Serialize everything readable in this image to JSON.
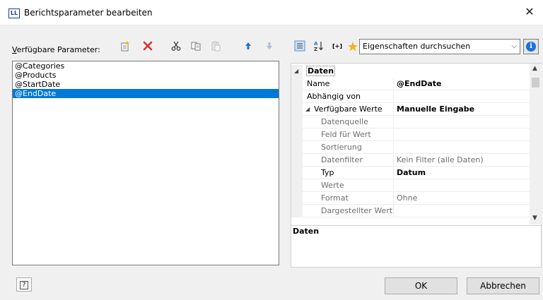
{
  "window": {
    "title": "Berichtsparameter bearbeiten",
    "app_icon_text": "LL"
  },
  "left_panel": {
    "label_accel": "V",
    "label_rest": "erfügbare Parameter:",
    "parameters": [
      "@Categories",
      "@Products",
      "@StartDate",
      "@EndDate"
    ],
    "selected_index": 3
  },
  "search": {
    "placeholder": "Eigenschaften durchsuchen"
  },
  "property_grid": {
    "category": "Daten",
    "rows": [
      {
        "name": "Name",
        "value": "@EndDate",
        "value_style": "bold",
        "sub": false
      },
      {
        "name": "Abhängig von",
        "value": "",
        "value_style": "",
        "sub": false
      },
      {
        "name": "Verfügbare Werte",
        "value": "Manuelle Eingabe",
        "value_style": "bold",
        "sub": false,
        "expander": true
      },
      {
        "name": "Datenquelle",
        "value": "",
        "value_style": "",
        "sub": true
      },
      {
        "name": "Feld für Wert",
        "value": "",
        "value_style": "",
        "sub": true
      },
      {
        "name": "Sortierung",
        "value": "",
        "value_style": "",
        "sub": true
      },
      {
        "name": "Datenfilter",
        "value": "Kein Filter (alle Daten)",
        "value_style": "dim",
        "sub": true
      },
      {
        "name": "Typ",
        "value": "Datum",
        "value_style": "bold",
        "sub": true,
        "name_dark": true
      },
      {
        "name": "Werte",
        "value": "",
        "value_style": "",
        "sub": true
      },
      {
        "name": "Format",
        "value": "Ohne",
        "value_style": "dim",
        "sub": true
      },
      {
        "name": "Dargestellter Wert",
        "value": "",
        "value_style": "",
        "sub": true
      }
    ],
    "description_title": "Daten"
  },
  "buttons": {
    "ok": "OK",
    "cancel": "Abbrechen",
    "help": "?"
  },
  "colors": {
    "selection": "#0078d7",
    "info": "#1e6fd8"
  }
}
